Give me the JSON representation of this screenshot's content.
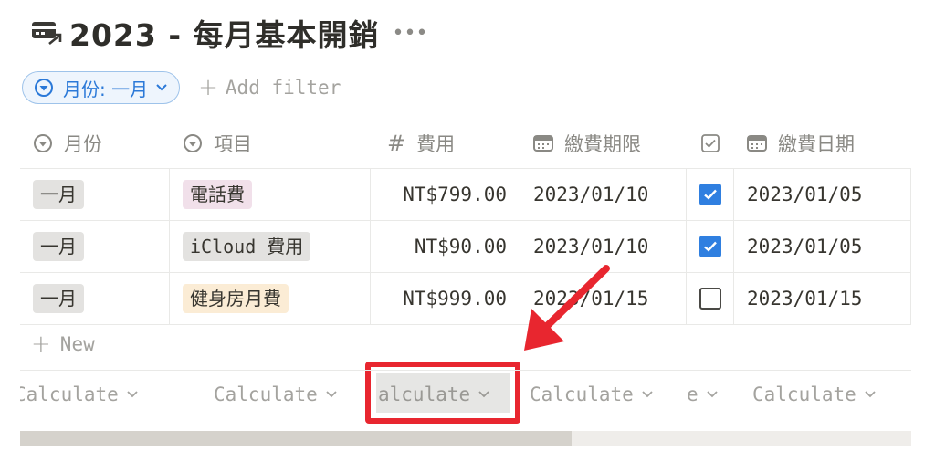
{
  "page": {
    "title": "2023 - 每月基本開銷",
    "title_icon": "credit-card-arrow-icon",
    "more_icon": "ellipsis-icon"
  },
  "filter": {
    "chip_label": "月份: 一月",
    "add_filter_label": "Add filter"
  },
  "columns": [
    {
      "label": "月份",
      "icon": "select-icon"
    },
    {
      "label": "項目",
      "icon": "select-icon"
    },
    {
      "label": "費用",
      "icon": "number-hash-icon"
    },
    {
      "label": "繳費期限",
      "icon": "calendar-icon"
    },
    {
      "label": "",
      "icon": "checkbox-icon"
    },
    {
      "label": "繳費日期",
      "icon": "calendar-icon"
    }
  ],
  "rows": [
    {
      "month": "一月",
      "item": "電話費",
      "item_color": "#f1e0ea",
      "cost": "NT$799.00",
      "due": "2023/01/10",
      "paid": true,
      "paid_date": "2023/01/05"
    },
    {
      "month": "一月",
      "item": "iCloud 費用",
      "item_color": "#e3e2e0",
      "cost": "NT$90.00",
      "due": "2023/01/10",
      "paid": true,
      "paid_date": "2023/01/05"
    },
    {
      "month": "一月",
      "item": "健身房月費",
      "item_color": "#fbecd5",
      "cost": "NT$999.00",
      "due": "2023/01/15",
      "paid": false,
      "paid_date": "2023/01/15"
    }
  ],
  "new_label": "New",
  "calculate": [
    "Calculate",
    "Calculate",
    "alculate",
    "Calculate",
    "e",
    "Calculate"
  ],
  "colors": {
    "accent": "#2b79d8",
    "highlight": "#e8262f",
    "checkbox_on": "#2f7fe0",
    "month_tag": "#e3e2e0"
  }
}
